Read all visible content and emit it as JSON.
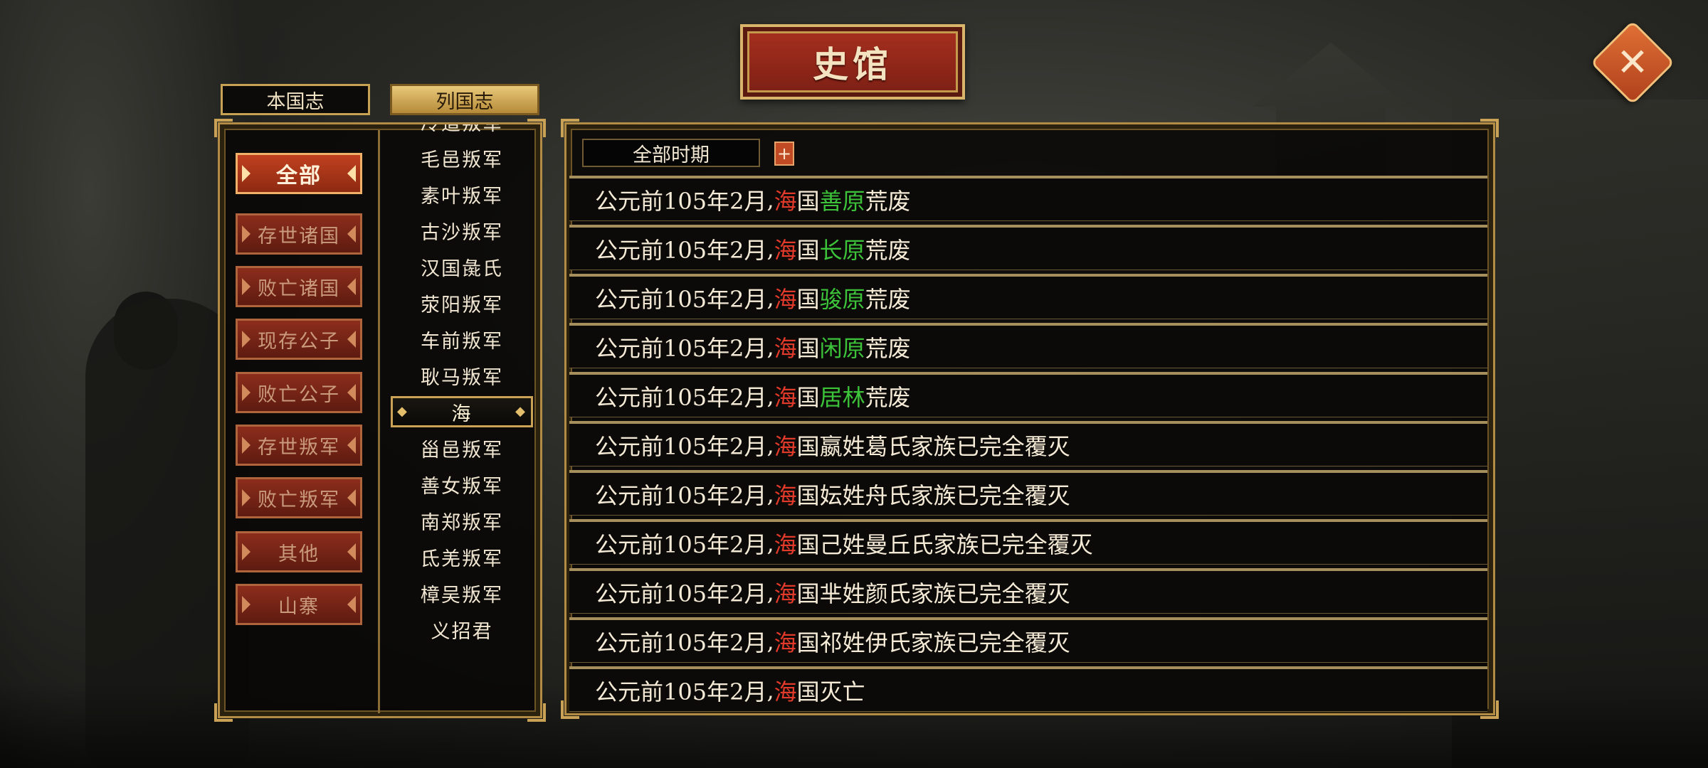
{
  "title": "史馆",
  "tabs": {
    "native": "本国志",
    "foreign": "列国志"
  },
  "categories": [
    {
      "label": "全部",
      "active": true
    },
    {
      "label": "存世诸国",
      "active": false
    },
    {
      "label": "败亡诸国",
      "active": false
    },
    {
      "label": "现存公子",
      "active": false
    },
    {
      "label": "败亡公子",
      "active": false
    },
    {
      "label": "存世叛军",
      "active": false
    },
    {
      "label": "败亡叛军",
      "active": false
    },
    {
      "label": "其他",
      "active": false
    },
    {
      "label": "山寨",
      "active": false
    }
  ],
  "states": [
    {
      "label": "冷道叛军"
    },
    {
      "label": "毛邑叛军"
    },
    {
      "label": "素叶叛军"
    },
    {
      "label": "古沙叛军"
    },
    {
      "label": "汉国彘氏"
    },
    {
      "label": "荥阳叛军"
    },
    {
      "label": "车前叛军"
    },
    {
      "label": "耿马叛军"
    },
    {
      "label": "海",
      "selected": true
    },
    {
      "label": "甾邑叛军"
    },
    {
      "label": "善女叛军"
    },
    {
      "label": "南郑叛军"
    },
    {
      "label": "氐羌叛军"
    },
    {
      "label": "樟吴叛军"
    },
    {
      "label": "义招君"
    }
  ],
  "filter": {
    "period": "全部时期",
    "add_label": "+"
  },
  "records": [
    {
      "date": "公元前105年2月",
      "sep": ",",
      "state": "海",
      "kingdom": "国",
      "place": "善原",
      "rest": "荒废"
    },
    {
      "date": "公元前105年2月",
      "sep": ",",
      "state": "海",
      "kingdom": "国",
      "place": "长原",
      "rest": "荒废"
    },
    {
      "date": "公元前105年2月",
      "sep": ",",
      "state": "海",
      "kingdom": "国",
      "place": "骏原",
      "rest": "荒废"
    },
    {
      "date": "公元前105年2月",
      "sep": ",",
      "state": "海",
      "kingdom": "国",
      "place": "闲原",
      "rest": "荒废"
    },
    {
      "date": "公元前105年2月",
      "sep": ",",
      "state": "海",
      "kingdom": "国",
      "place": "居林",
      "rest": "荒废"
    },
    {
      "date": "公元前105年2月",
      "sep": ",",
      "state": "海",
      "kingdom": "国",
      "place": "",
      "rest": "嬴姓葛氏家族已完全覆灭"
    },
    {
      "date": "公元前105年2月",
      "sep": ",",
      "state": "海",
      "kingdom": "国",
      "place": "",
      "rest": "妘姓舟氏家族已完全覆灭"
    },
    {
      "date": "公元前105年2月",
      "sep": ",",
      "state": "海",
      "kingdom": "国",
      "place": "",
      "rest": "己姓曼丘氏家族已完全覆灭"
    },
    {
      "date": "公元前105年2月",
      "sep": ",",
      "state": "海",
      "kingdom": "国",
      "place": "",
      "rest": "芈姓颜氏家族已完全覆灭"
    },
    {
      "date": "公元前105年2月",
      "sep": ",",
      "state": "海",
      "kingdom": "国",
      "place": "",
      "rest": "祁姓伊氏家族已完全覆灭"
    },
    {
      "date": "公元前105年2月",
      "sep": ",",
      "state": "海",
      "kingdom": "国",
      "place": "",
      "rest": "灭亡"
    }
  ],
  "colors": {
    "accent_gold": "#c9a255",
    "state_red": "#e23a2a",
    "place_green": "#3cc33a",
    "button_red": "#8c2d1c"
  },
  "icons": {
    "close": "close-icon"
  }
}
